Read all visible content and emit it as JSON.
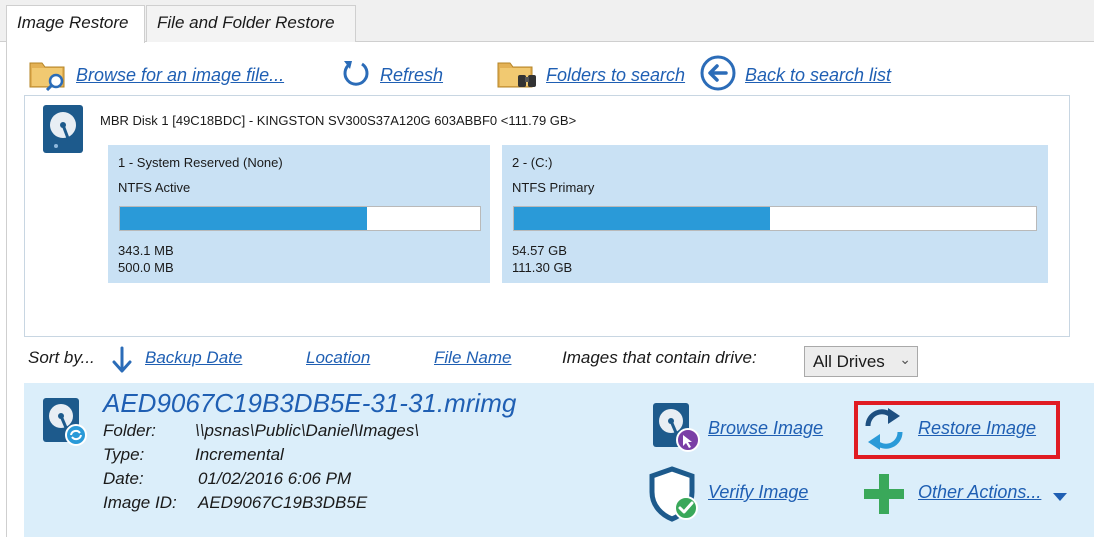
{
  "tabs": [
    {
      "label": "Image Restore",
      "active": true
    },
    {
      "label": "File and Folder Restore",
      "active": false
    }
  ],
  "toolbar": {
    "browse_label": "Browse for an image file...",
    "refresh_label": "Refresh",
    "folders_label": "Folders to search",
    "back_label": "Back to search list"
  },
  "disk": {
    "title": "MBR Disk 1 [49C18BDC] - KINGSTON SV300S37A120G 603ABBF0  <111.79 GB>",
    "partitions": [
      {
        "name": "1 - System Reserved (None)",
        "fs": "NTFS Active",
        "used": "343.1 MB",
        "total": "500.0 MB",
        "fill": 0.686
      },
      {
        "name": "2 -  (C:)",
        "fs": "NTFS Primary",
        "used": "54.57 GB",
        "total": "111.30 GB",
        "fill": 0.49
      }
    ]
  },
  "sort": {
    "label": "Sort by...",
    "backup_date": "Backup Date",
    "location": "Location",
    "file_name": "File Name",
    "drive_label": "Images that contain drive:",
    "drive_selected": "All Drives"
  },
  "image": {
    "title": "AED9067C19B3DB5E-31-31.mrimg",
    "folder_k": "Folder:",
    "folder_v": "\\\\psnas\\Public\\Daniel\\Images\\",
    "type_k": "Type:",
    "type_v": "Incremental",
    "date_k": "Date:",
    "date_v": "01/02/2016 6:06 PM",
    "id_k": "Image ID:",
    "id_v": "AED9067C19B3DB5E"
  },
  "actions": {
    "browse": "Browse Image",
    "restore": "Restore Image",
    "verify": "Verify Image",
    "other": "Other Actions..."
  },
  "colors": {
    "link": "#1f5fb3",
    "bar_fill": "#2a9ad8",
    "partition_bg": "#c9e1f4",
    "row_bg": "#dbeefa",
    "highlight": "#e01b22"
  }
}
